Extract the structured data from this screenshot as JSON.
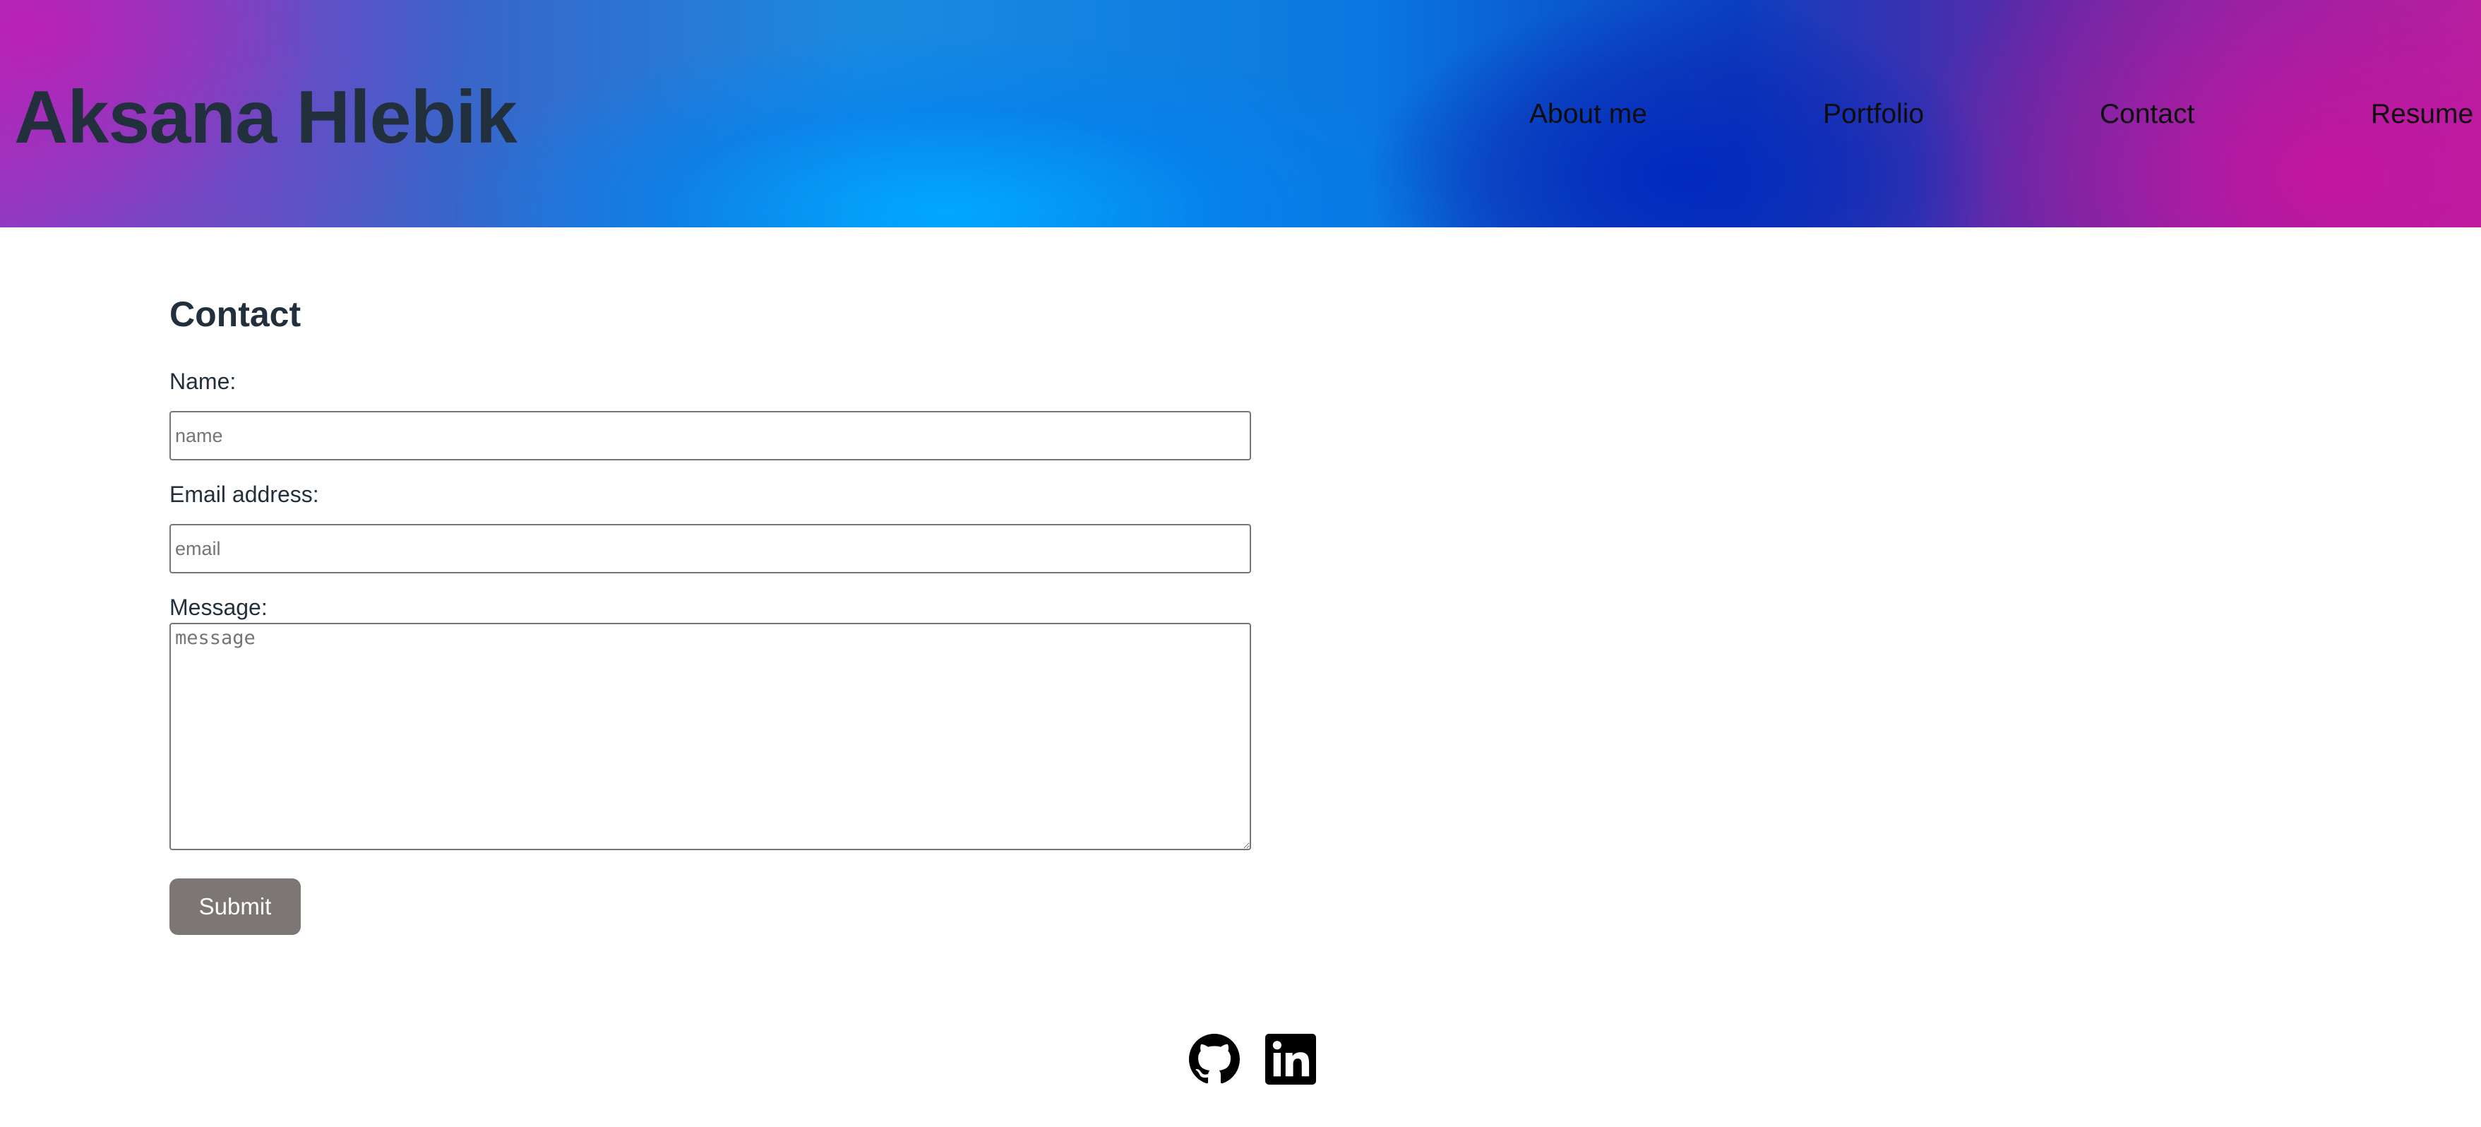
{
  "header": {
    "site_title": "Aksana Hlebik",
    "nav": {
      "about": "About me",
      "portfolio": "Portfolio",
      "contact": "Contact",
      "resume": "Resume"
    }
  },
  "contact": {
    "title": "Contact",
    "name_label": "Name:",
    "name_placeholder": "name",
    "name_value": "",
    "email_label": "Email address:",
    "email_placeholder": "email",
    "email_value": "",
    "message_label": "Message:",
    "message_placeholder": "message",
    "message_value": "",
    "submit_label": "Submit"
  },
  "footer": {
    "icons": [
      "github-icon",
      "linkedin-icon"
    ]
  },
  "colors": {
    "heading_text": "#22303e",
    "submit_bg": "#7c7674",
    "input_border": "#767676"
  }
}
